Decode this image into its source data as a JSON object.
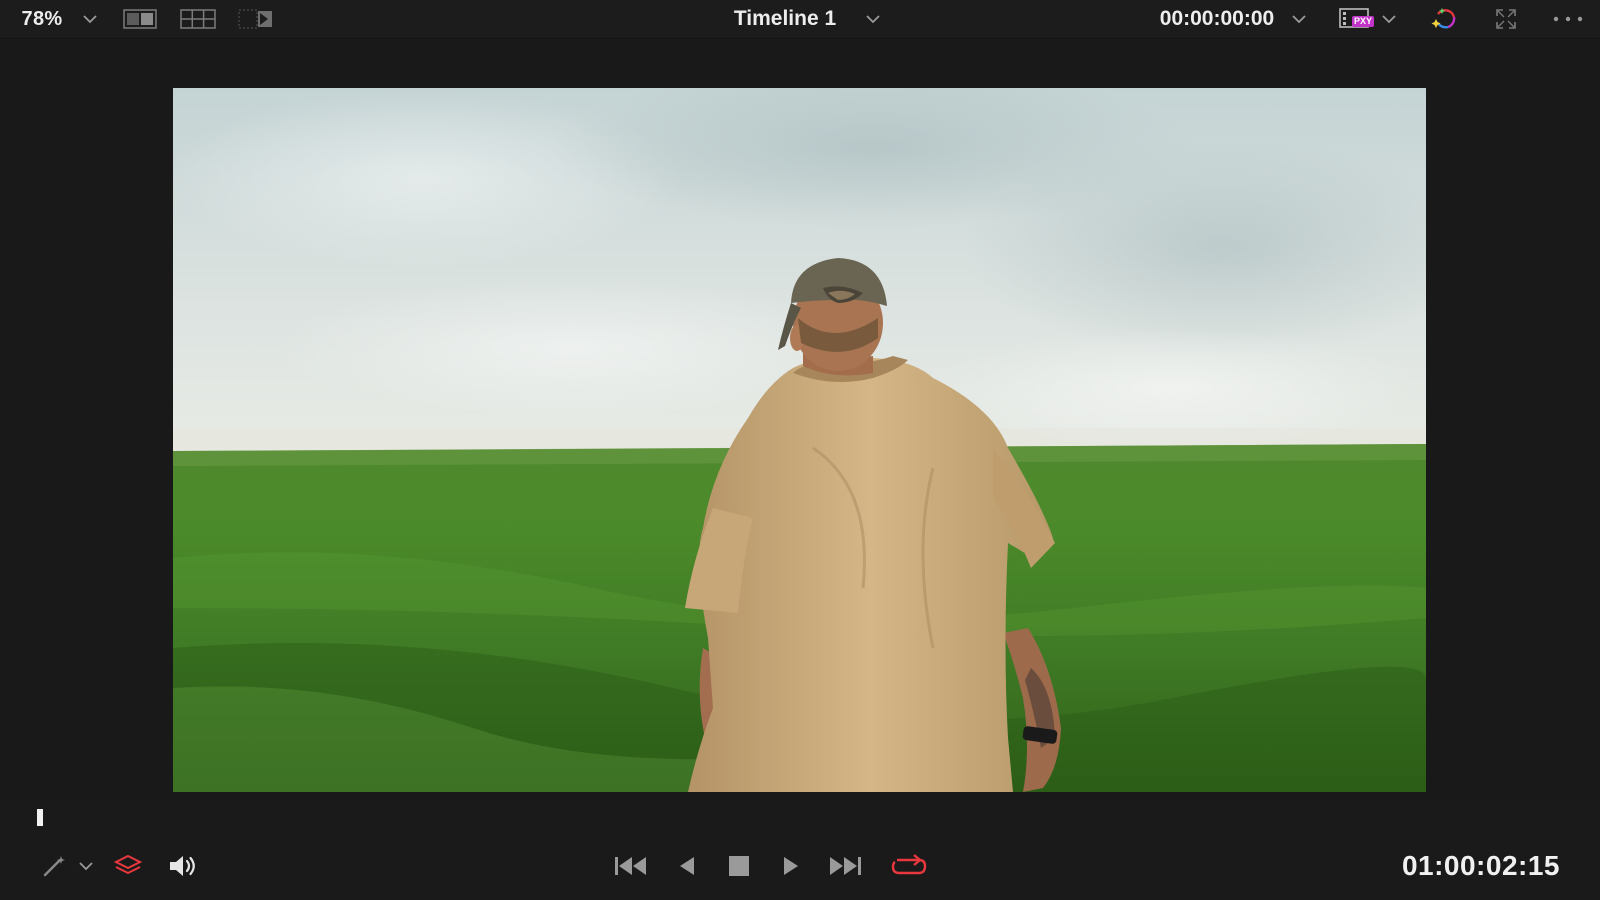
{
  "toolbar": {
    "zoom": "78%",
    "timeline_title": "Timeline 1",
    "source_timecode": "00:00:00:00",
    "proxy_badge": "PXY"
  },
  "viewer": {
    "frame_description_icon": "video-frame",
    "playhead_progress": 0.0
  },
  "transport": {
    "record_timecode": "01:00:02:15",
    "loop_color": "#e8383d",
    "layers_color": "#e8383d"
  },
  "colors": {
    "background": "#1a1a1b",
    "icon": "#9a9a9a",
    "text": "#ededed",
    "accent_red": "#e8383d",
    "proxy_magenta": "#c233c9"
  }
}
